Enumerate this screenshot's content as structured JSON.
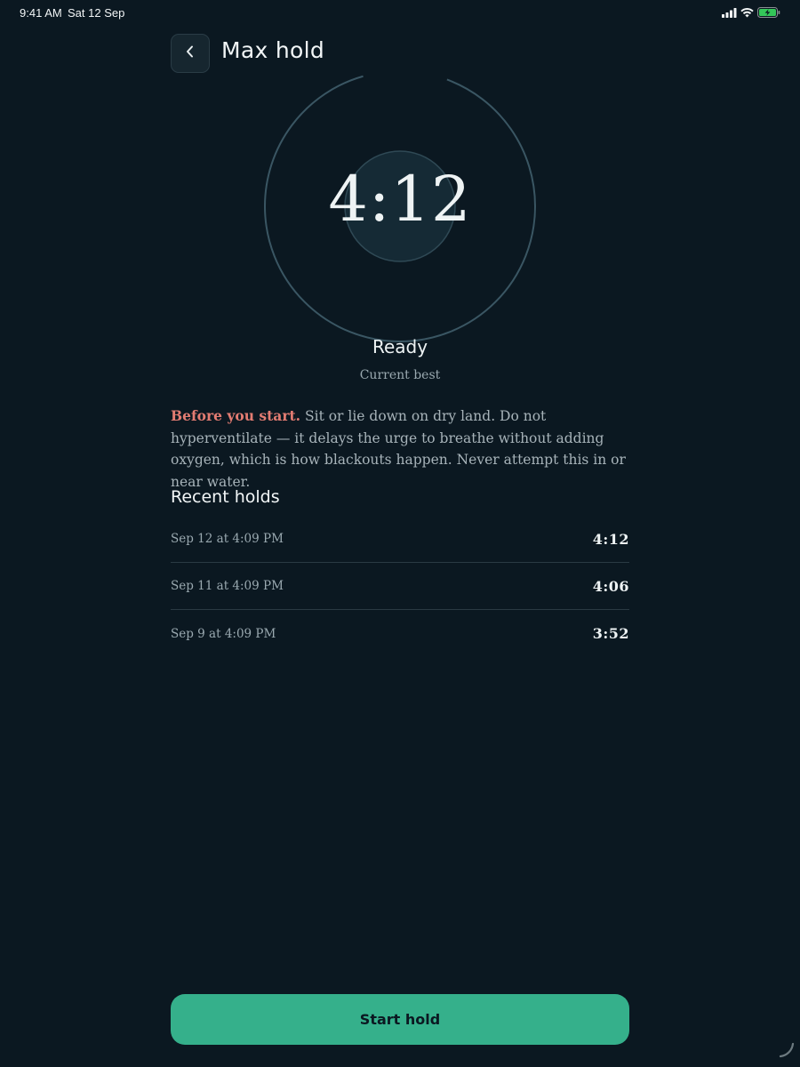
{
  "status_bar": {
    "time": "9:41 AM",
    "date": "Sat 12 Sep",
    "icons": [
      "signal-icon",
      "wifi-icon",
      "battery-charging-icon"
    ],
    "battery_color": "#34c759"
  },
  "header": {
    "back_icon": "chevron-left-icon",
    "title": "Max hold"
  },
  "timer": {
    "value": "4:12",
    "status": "Ready",
    "caption": "Current best"
  },
  "warning": {
    "lead": "Before you start.",
    "body": " Sit or lie down on dry land. Do not hyperventilate — it delays the urge to breathe without adding oxygen, which is how blackouts happen. Never attempt this in or near water."
  },
  "recent": {
    "title": "Recent holds",
    "items": [
      {
        "date": "Sep 12 at 4:09 PM",
        "time": "4:12"
      },
      {
        "date": "Sep 11 at 4:09 PM",
        "time": "4:06"
      },
      {
        "date": "Sep 9 at 4:09 PM",
        "time": "3:52"
      }
    ]
  },
  "actions": {
    "start_label": "Start hold"
  },
  "colors": {
    "background": "#0b1821",
    "accent": "#35b08b",
    "warning": "#e37c72",
    "ring": "#3a5663"
  }
}
